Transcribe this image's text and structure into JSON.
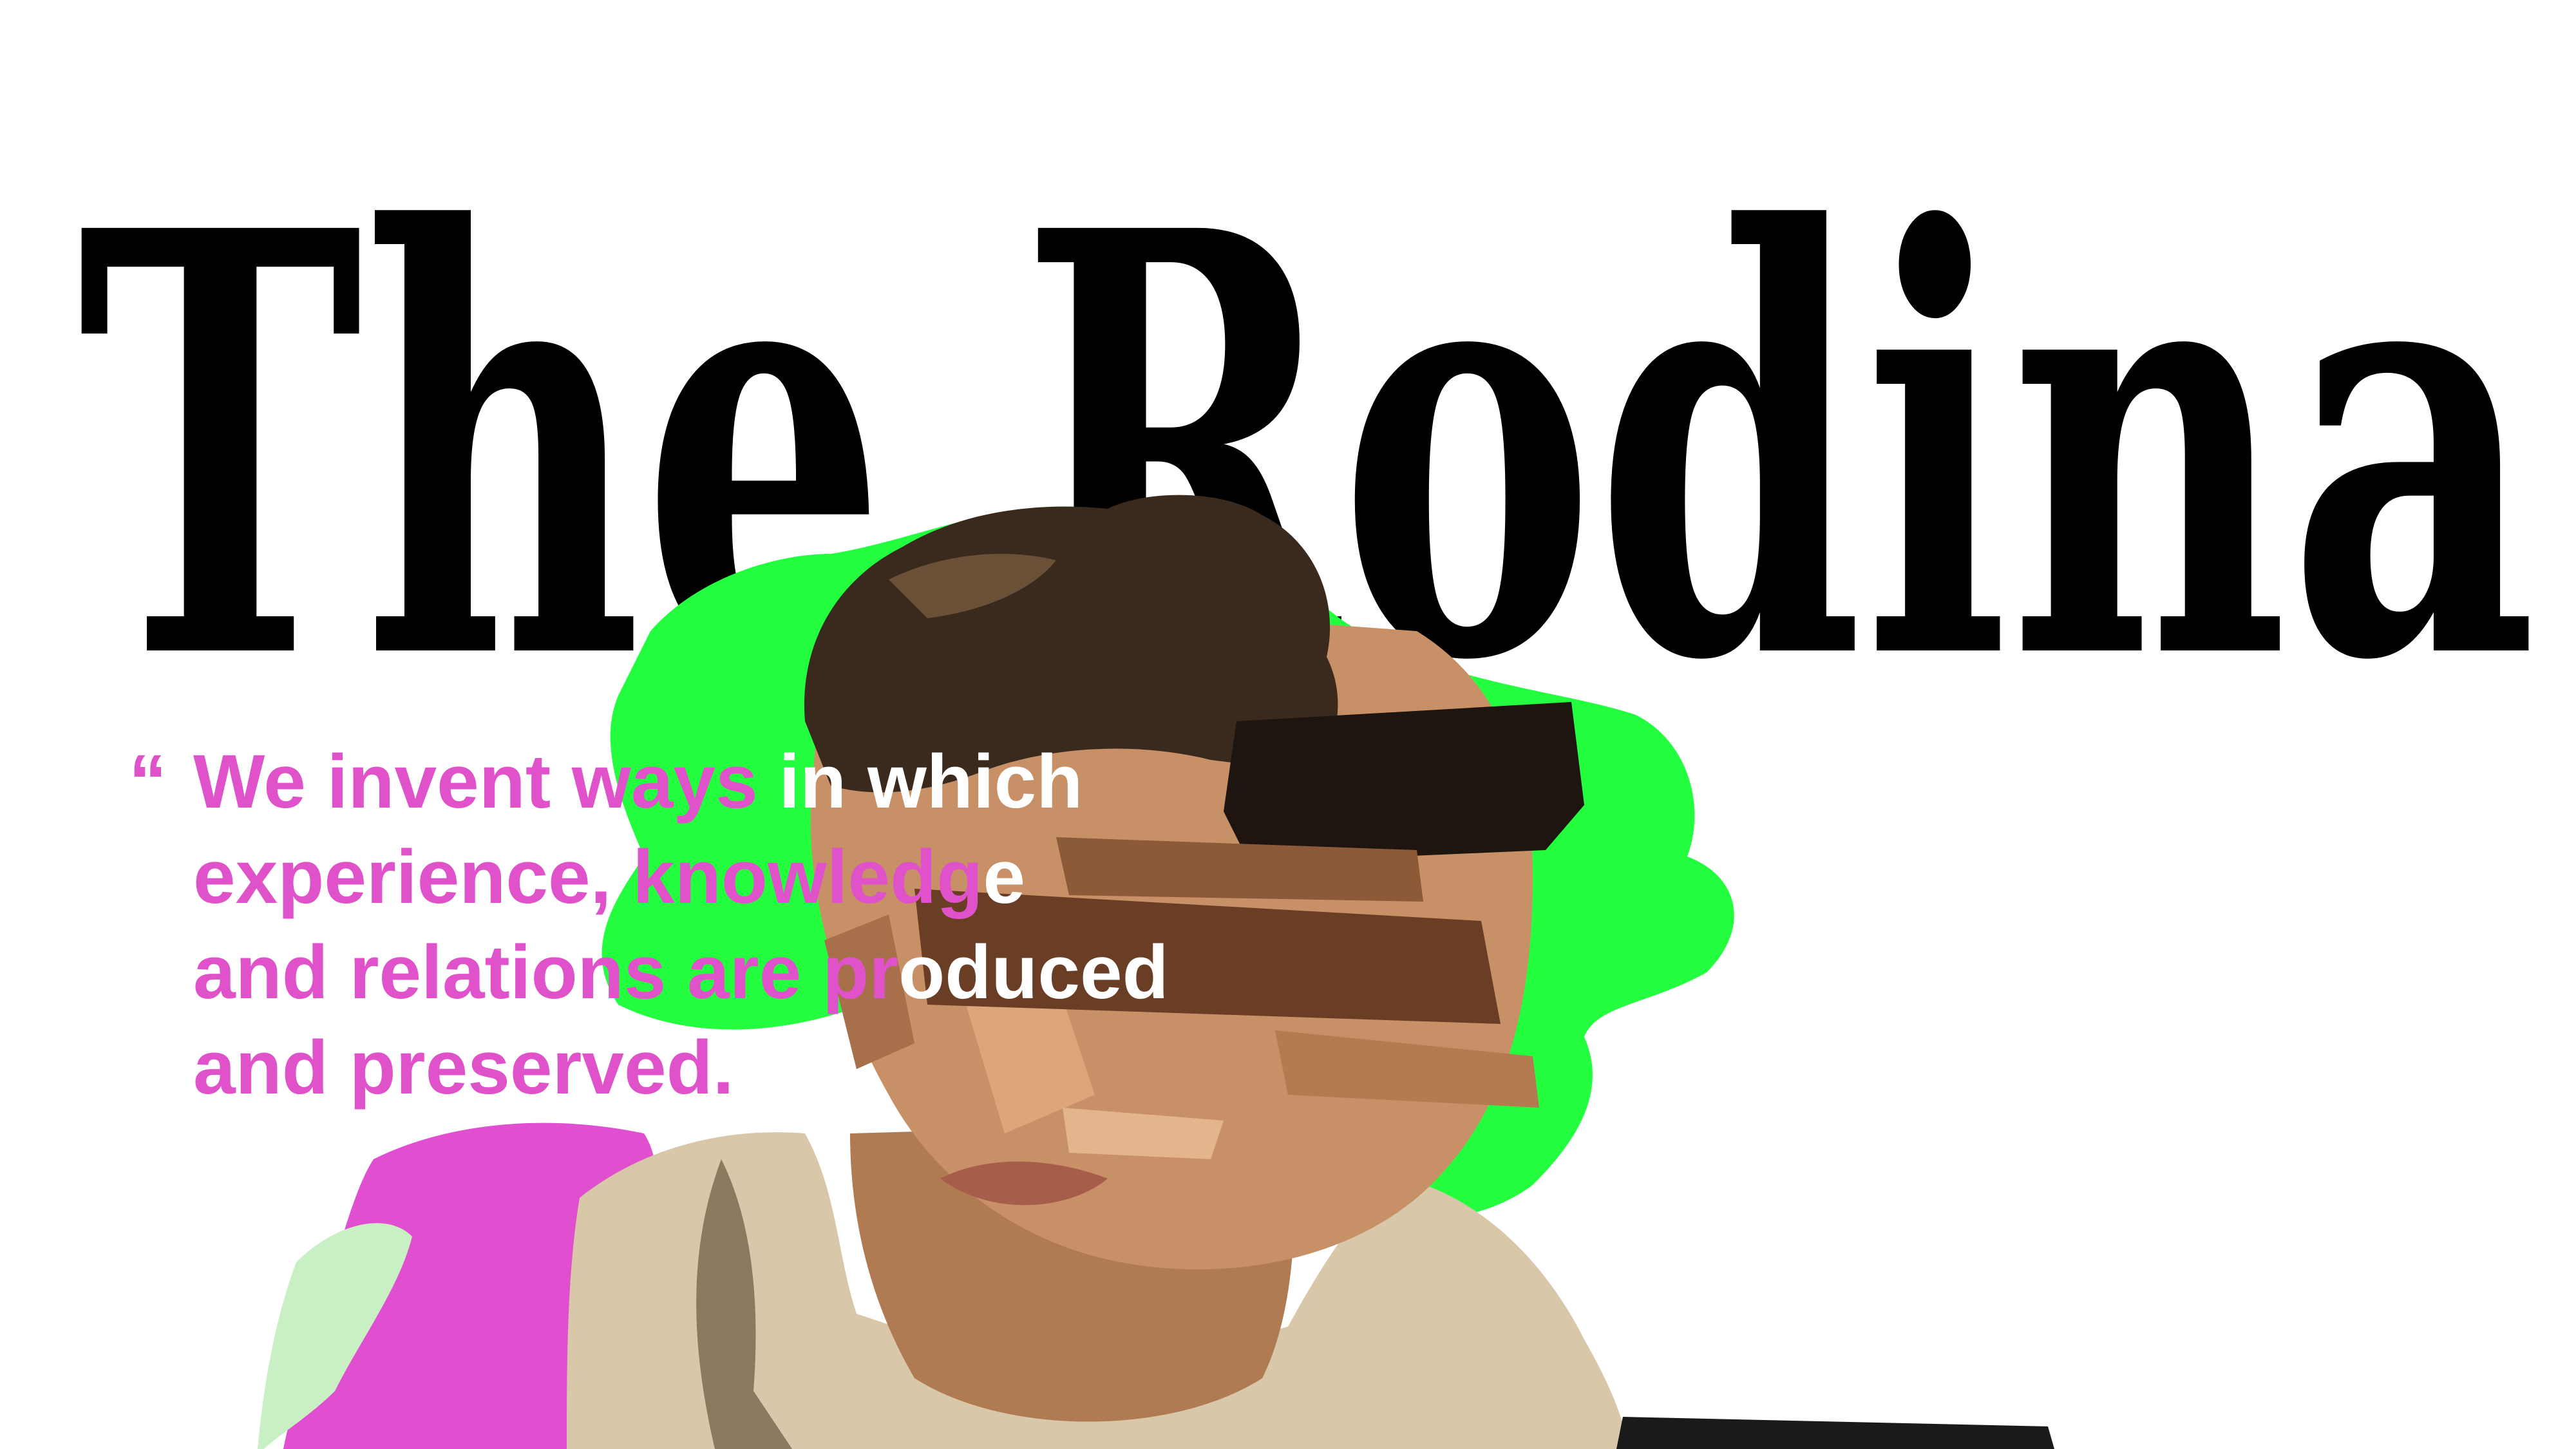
{
  "wordmark": {
    "text": "The Rodina",
    "color": "#000000"
  },
  "quote": {
    "open_mark": "“",
    "line1_pink": "We invent ways",
    "line1_white": " in which",
    "line2_pink": "experience, knowledg",
    "line2_white": "e",
    "line3_pink": "and relations are pr",
    "line3_white": "oduced",
    "line4_pink": "and preserved.",
    "close_mark": " “",
    "color_pink": "#e052c9",
    "color_white": "#ffffff"
  },
  "artwork": {
    "accent_green": "#23ff3f",
    "accent_magenta": "#e04fcf",
    "skin": "#c89066",
    "hair": "#3a2a1e"
  }
}
